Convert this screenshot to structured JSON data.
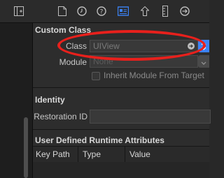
{
  "topbar": {
    "icons": [
      "sidebar-toggle-icon",
      "file-icon",
      "clock-icon",
      "help-icon",
      "identity-inspector-icon",
      "attributes-inspector-icon",
      "size-inspector-icon",
      "connections-inspector-icon"
    ],
    "colors": {
      "active": "#3b82f6",
      "inactive": "#bdbdbd"
    }
  },
  "custom_class": {
    "title": "Custom Class",
    "class_label": "Class",
    "class_value": "UIView",
    "module_label": "Module",
    "module_placeholder": "None",
    "inherit_label": "Inherit Module From Target"
  },
  "identity": {
    "title": "Identity",
    "restoration_id_label": "Restoration ID",
    "restoration_id_value": ""
  },
  "runtime_attributes": {
    "title": "User Defined Runtime Attributes",
    "columns": [
      "Key Path",
      "Type",
      "Value"
    ]
  },
  "annotation": {
    "color": "#e8201c"
  }
}
